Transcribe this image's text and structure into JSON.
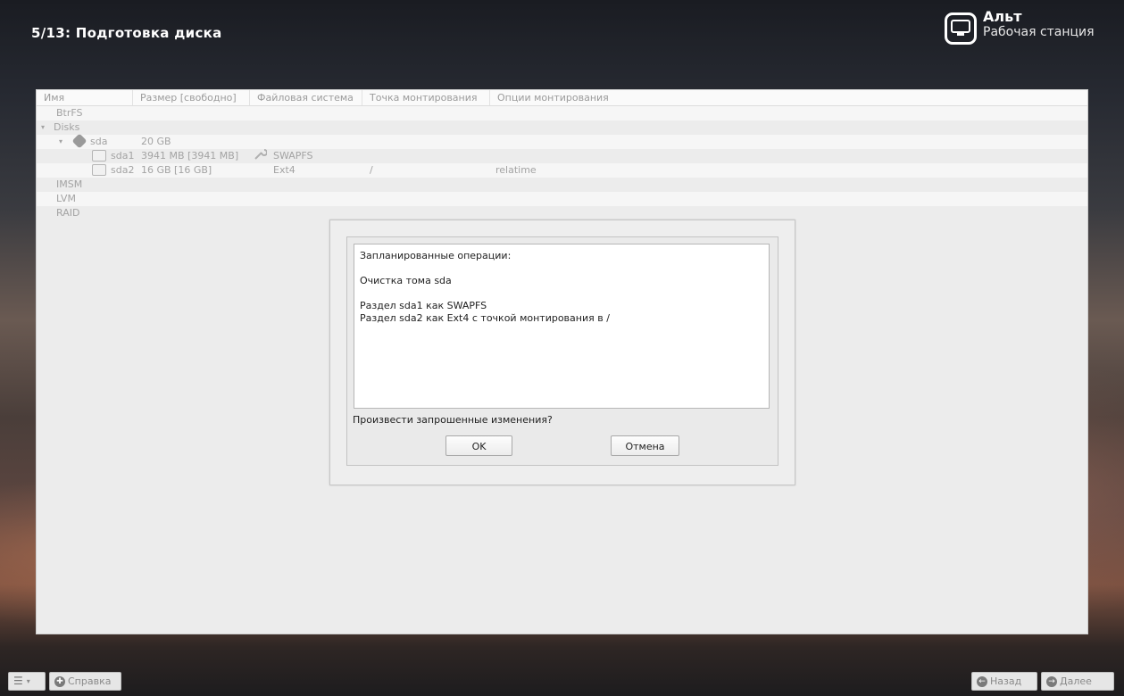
{
  "header": {
    "step_title": "5/13: Подготовка диска",
    "brand_name": "Альт",
    "brand_sub": "Рабочая станция",
    "brand_icon": "monitor-icon"
  },
  "table": {
    "columns": [
      "Имя",
      "Размер [свободно]",
      "Файловая система",
      "Точка монтирования",
      "Опции монтирования"
    ],
    "rows": {
      "btrfs": "BtrFS",
      "disks": "Disks",
      "sda": {
        "name": "sda",
        "size": "20 GB"
      },
      "sda1": {
        "name": "sda1",
        "size": "3941 MB [3941 MB]",
        "fs": "SWAPFS"
      },
      "sda2": {
        "name": "sda2",
        "size": "16 GB [16 GB]",
        "fs": "Ext4",
        "mount": "/",
        "options": "relatime"
      },
      "imsm": "IMSM",
      "lvm": "LVM",
      "raid": "RAID"
    }
  },
  "dialog": {
    "heading": "Запланированные операции:",
    "op_clear": "Очистка тома sda",
    "op_sda1": "Раздел sda1 как SWAPFS",
    "op_sda2": "Раздел sda2 как Ext4 с точкой монтирования в /",
    "question": "Произвести запрошенные изменения?",
    "ok_label": "OK",
    "cancel_label": "Отмена"
  },
  "footer": {
    "menu_icon": "list-icon",
    "help_label": "Справка",
    "back_label": "Назад",
    "next_label": "Далее"
  }
}
